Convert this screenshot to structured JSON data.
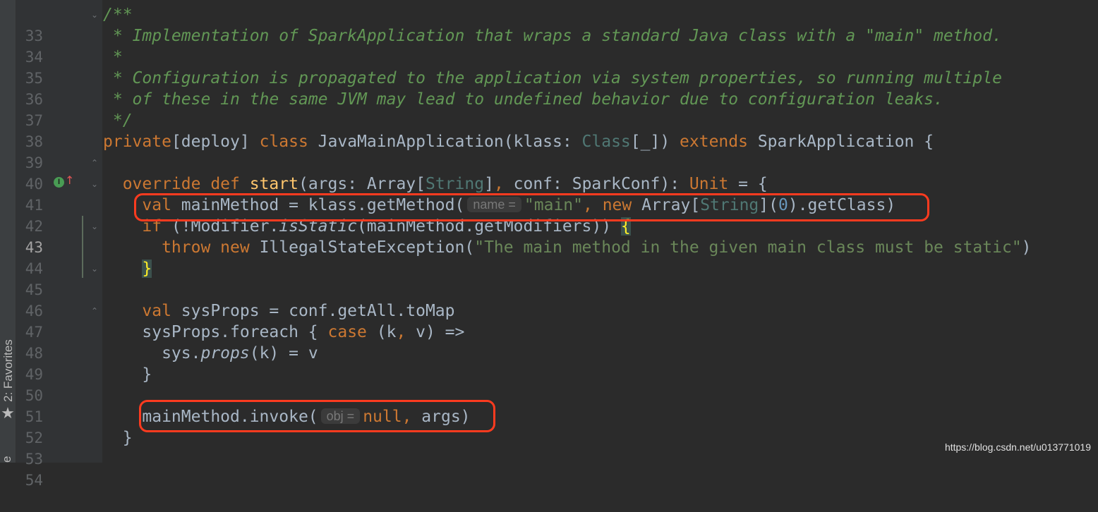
{
  "sidebar": {
    "favorites_label": "2: Favorites",
    "star_icon": "star-icon"
  },
  "gutter": {
    "line_numbers": [
      "33",
      "34",
      "35",
      "36",
      "37",
      "38",
      "39",
      "40",
      "41",
      "42",
      "43",
      "44",
      "45",
      "46",
      "47",
      "48",
      "49",
      "50",
      "51",
      "52",
      "53",
      "54"
    ],
    "current_line": "43",
    "implements_badge": "I",
    "implements_arrow": "↑"
  },
  "code": {
    "l33": "/**",
    "l34": " * Implementation of SparkApplication that wraps a standard Java class with a \"main\" method.",
    "l35": " *",
    "l36": " * Configuration is propagated to the application via system properties, so running multiple",
    "l37": " * of these in the same JVM may lead to undefined behavior due to configuration leaks.",
    "l38": " */",
    "l39": {
      "kw_private": "private",
      "deploy": "[deploy] ",
      "kw_class": "class",
      "name": " JavaMainApplication(klass: ",
      "type_class": "Class",
      "generic": "[_]) ",
      "kw_extends": "extends",
      "rest": " SparkApplication {"
    },
    "l41": {
      "kw_override": "  override def ",
      "fn_start": "start",
      "p1": "(args: Array[",
      "t_string": "String",
      "p2": "]",
      "comma": ",",
      "p3": " conf: SparkConf): ",
      "t_unit": "Unit",
      "p4": " = {"
    },
    "l42": {
      "kw_val": "    val",
      "p1": " mainMethod = klass.getMethod(",
      "hint": "name =",
      "str": "\"main\"",
      "comma": ",",
      "kw_new": " new",
      "p2": " Array[",
      "t_string": "String",
      "p3": "](",
      "num": "0",
      "p4": ").getClass)"
    },
    "l43": {
      "kw_if": "    if",
      "p1": " (!Modifier.",
      "it": "isStatic",
      "p2": "(mainMethod.getModifiers)) ",
      "brace": "{"
    },
    "l44": {
      "kw_throw": "      throw new",
      "p1": " IllegalStateException(",
      "str": "\"The main method in the given main class must be static\"",
      "p2": ")"
    },
    "l45": {
      "pad": "    ",
      "brace": "}"
    },
    "l47": "    val sysProps = conf.getAll.toMap",
    "l48": {
      "p1": "    sysProps.foreach { ",
      "kw_case": "case",
      "p2": " (k",
      "comma": ",",
      "p3": " v) =>"
    },
    "l49": {
      "p1": "      sys.",
      "it": "props",
      "p2": "(k) = v"
    },
    "l50": "    }",
    "l52": {
      "p1": "    mainMethod.invoke(",
      "hint": "obj =",
      "kw_null": "null",
      "comma": ",",
      "p2": " args)"
    },
    "l53": "  }"
  },
  "watermark": "https://blog.csdn.net/u013771019",
  "colors": {
    "background": "#2b2b2b",
    "gutter": "#313335",
    "keyword": "#cc7832",
    "string": "#6a8759",
    "comment": "#629755",
    "highlight_box": "#ff3b1f"
  }
}
